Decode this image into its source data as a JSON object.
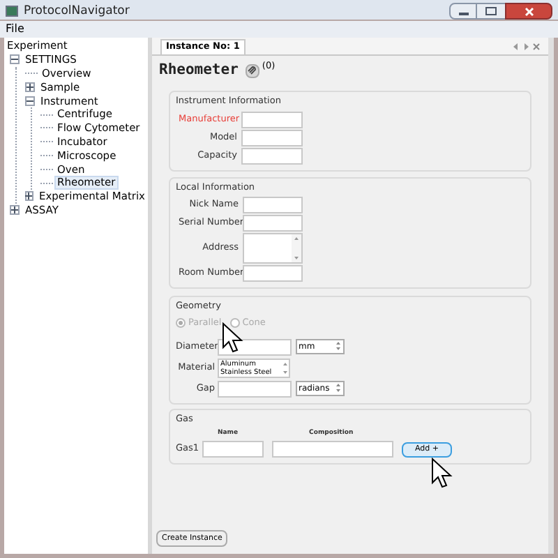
{
  "window": {
    "title": "ProtocolNavigator"
  },
  "menu": [
    "File"
  ],
  "tree": [
    {
      "label": "Experiment",
      "selected": false,
      "children": [
        {
          "label": "SETTINGS",
          "expanded": true,
          "selected": false,
          "children": [
            {
              "label": "Overview",
              "selected": false
            },
            {
              "label": "Sample",
              "expanded": false,
              "selected": false
            },
            {
              "label": "Instrument",
              "expanded": true,
              "selected": false,
              "children": [
                {
                  "label": "Centrifuge",
                  "selected": false
                },
                {
                  "label": "Flow Cytometer",
                  "selected": false
                },
                {
                  "label": "Incubator",
                  "selected": false
                },
                {
                  "label": "Microscope",
                  "selected": false
                },
                {
                  "label": "Oven",
                  "selected": false
                },
                {
                  "label": "Rheometer",
                  "selected": true
                }
              ]
            },
            {
              "label": "Experimental Matrix",
              "expanded": false,
              "selected": false
            }
          ]
        },
        {
          "label": "ASSAY",
          "expanded": false,
          "selected": false
        }
      ]
    }
  ],
  "tabs": [
    {
      "label": "Instance No: 1",
      "selected": true
    }
  ],
  "heading": {
    "title": "Rheometer",
    "count": "(0)"
  },
  "instrument_information": {
    "title": "Instrument Information",
    "fields": [
      {
        "label": "Manufacturer",
        "required": true
      },
      {
        "label": "Model",
        "required": false
      },
      {
        "label": "Capacity",
        "required": false
      }
    ]
  },
  "local_information": {
    "title": "Local Information",
    "fields": [
      {
        "label": "Nick Name",
        "kind": "text"
      },
      {
        "label": "Serial Number",
        "kind": "text"
      },
      {
        "label": "Address",
        "kind": "multiline"
      },
      {
        "label": "Room Number",
        "kind": "text"
      }
    ]
  },
  "geometry": {
    "title": "Geometry",
    "radios": [
      {
        "label": "Parallel",
        "selected": true,
        "disabled": true
      },
      {
        "label": "Cone",
        "selected": false,
        "disabled": true
      }
    ],
    "fields": [
      {
        "label": "Diameter",
        "kind": "unit",
        "unit": "mm"
      },
      {
        "label": "Material",
        "kind": "list",
        "options": [
          "Aluminum",
          "Stainless Steel"
        ]
      },
      {
        "label": "Gap",
        "kind": "unit",
        "unit": "radians"
      }
    ]
  },
  "gas": {
    "title": "Gas",
    "columns": [
      "Name",
      "Composition"
    ],
    "rows": [
      {
        "label": "Gas1"
      }
    ],
    "add_button": "Add +"
  },
  "create_button": "Create Instance"
}
